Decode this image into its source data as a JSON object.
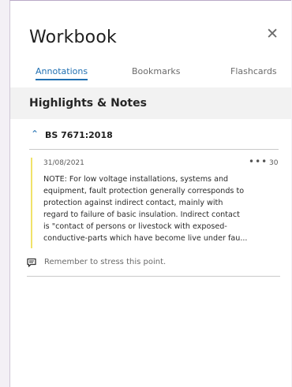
{
  "workbook": {
    "title": "Workbook",
    "close_icon": "close-icon"
  },
  "tabs": [
    {
      "label": "Annotations",
      "active": true
    },
    {
      "label": "Bookmarks",
      "active": false
    },
    {
      "label": "Flashcards",
      "active": false
    }
  ],
  "section": {
    "title": "Highlights & Notes"
  },
  "group": {
    "label": "BS 7671:2018",
    "expanded": true,
    "chevron_icon": "chevron-up-icon"
  },
  "annotation": {
    "date": "31/08/2021",
    "more_label": "•••",
    "page": "30",
    "highlight_color": "#f0e36a",
    "text_lines": [
      "NOTE: For low voltage installations, systems and",
      "equipment, fault protection generally corresponds to",
      "protection against indirect contact, mainly with",
      "regard to failure of basic insulation. Indirect contact",
      "is \"contact of persons or livestock with exposed-",
      "conductive-parts which have become live under fau..."
    ],
    "comment_icon": "comment-icon",
    "comment": "Remember to stress this point."
  },
  "colors": {
    "accent": "#1f6fb2",
    "section_bg": "#f2f2f2"
  }
}
